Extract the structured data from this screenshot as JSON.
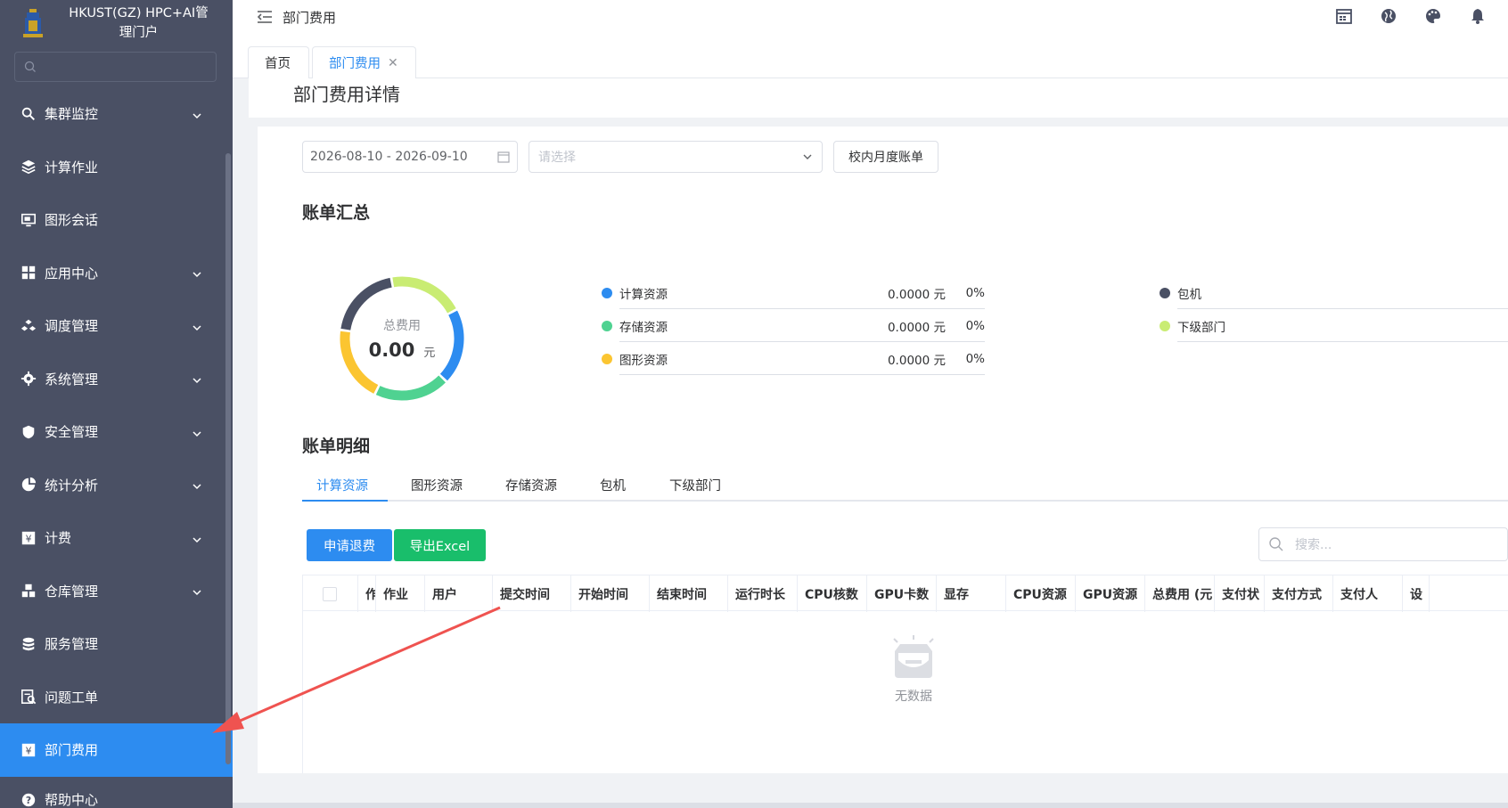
{
  "sidebar": {
    "brand_line1": "HKUST(GZ) HPC+AI管",
    "brand_line2": "理门户",
    "search_placeholder": "",
    "items": [
      {
        "label": "集群监控",
        "icon": "cluster-monitor-icon",
        "expandable": true
      },
      {
        "label": "计算作业",
        "icon": "layers-icon",
        "expandable": false
      },
      {
        "label": "图形会话",
        "icon": "monitor-icon",
        "expandable": false
      },
      {
        "label": "应用中心",
        "icon": "grid-icon",
        "expandable": true
      },
      {
        "label": "调度管理",
        "icon": "cubes-icon",
        "expandable": true
      },
      {
        "label": "系统管理",
        "icon": "gear-icon",
        "expandable": true
      },
      {
        "label": "安全管理",
        "icon": "shield-icon",
        "expandable": true
      },
      {
        "label": "统计分析",
        "icon": "pie-icon",
        "expandable": true
      },
      {
        "label": "计费",
        "icon": "yen-icon",
        "expandable": true
      },
      {
        "label": "仓库管理",
        "icon": "warehouse-icon",
        "expandable": true
      },
      {
        "label": "服务管理",
        "icon": "service-icon",
        "expandable": false
      },
      {
        "label": "问题工单",
        "icon": "ticket-icon",
        "expandable": false
      },
      {
        "label": "部门费用",
        "icon": "yen-icon",
        "expandable": false,
        "active": true
      },
      {
        "label": "帮助中心",
        "icon": "help-icon",
        "expandable": false
      }
    ]
  },
  "topbar": {
    "breadcrumb": "部门费用"
  },
  "tabs": {
    "home": "首页",
    "active": "部门费用"
  },
  "page": {
    "title": "部门费用详情",
    "date_range": "2026-08-10 - 2026-09-10",
    "select_placeholder": "请选择",
    "monthly_bill_button": "校内月度账单",
    "summary_title": "账单汇总",
    "detail_title": "账单明细"
  },
  "summary": {
    "total_label": "总费用",
    "total_value": "0.00",
    "total_unit": "元",
    "legend_left": [
      {
        "name": "计算资源",
        "amount": "0.0000 元",
        "pct": "0%",
        "color": "#2d8cf0"
      },
      {
        "name": "存储资源",
        "amount": "0.0000 元",
        "pct": "0%",
        "color": "#4fd291"
      },
      {
        "name": "图形资源",
        "amount": "0.0000 元",
        "pct": "0%",
        "color": "#fbc531"
      }
    ],
    "legend_right": [
      {
        "name": "包机",
        "color": "#4a5064"
      },
      {
        "name": "下级部门",
        "color": "#c9ec73"
      }
    ]
  },
  "detail_tabs": [
    "计算资源",
    "图形资源",
    "存储资源",
    "包机",
    "下级部门"
  ],
  "actions": {
    "refund_button": "申请退费",
    "export_button": "导出Excel",
    "search_placeholder": "搜索..."
  },
  "table": {
    "columns": [
      "作",
      "作业",
      "用户",
      "提交时间",
      "开始时间",
      "结束时间",
      "运行时长",
      "CPU核数",
      "GPU卡数",
      "显存",
      "CPU资源",
      "GPU资源",
      "总费用 (元",
      "支付状",
      "支付方式",
      "支付人",
      "设"
    ],
    "empty_text": "无数据"
  },
  "colors": {
    "sidebar_bg": "#4a5064",
    "accent": "#2d8cf0",
    "success": "#19be6b",
    "annotation_arrow": "#ef5350"
  }
}
